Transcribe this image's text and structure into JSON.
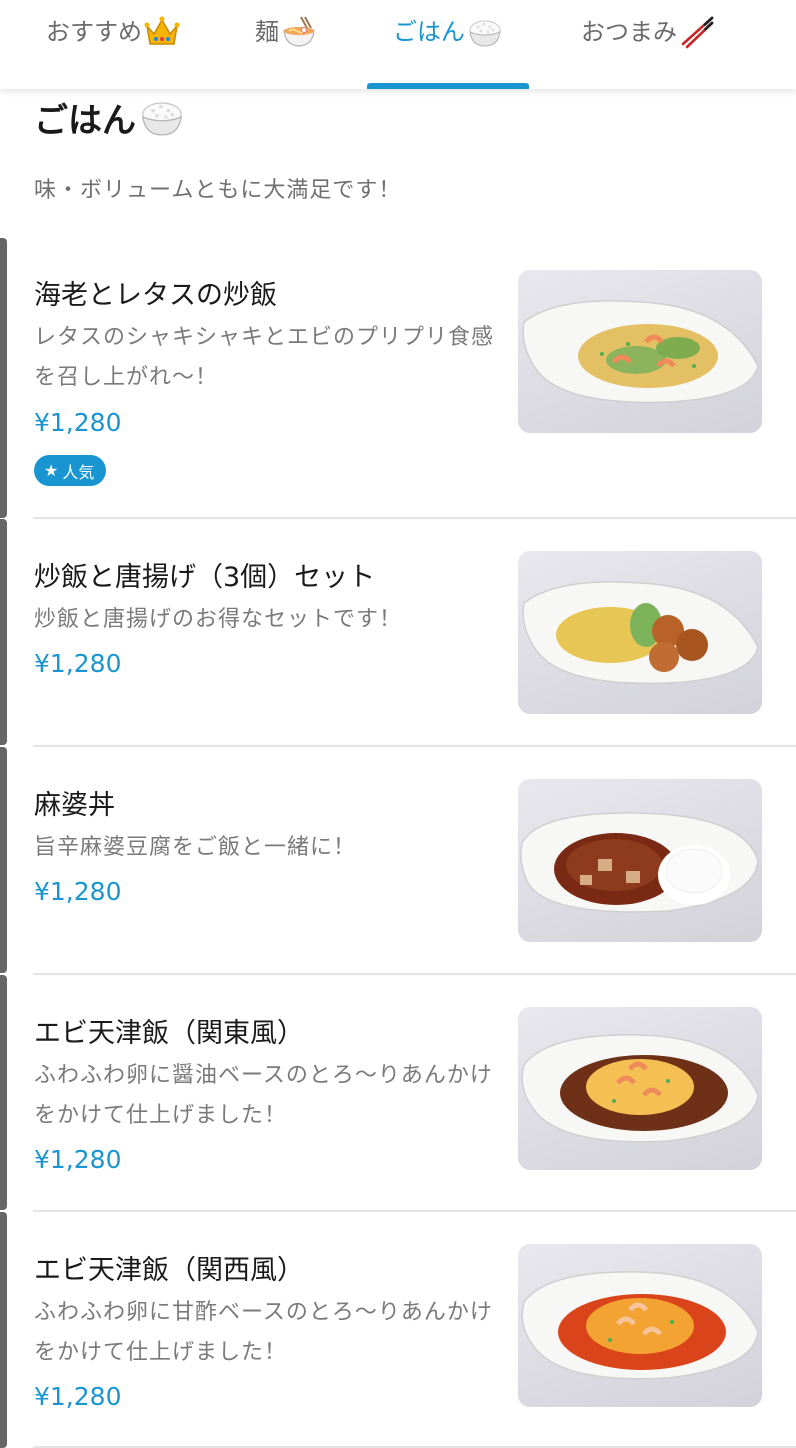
{
  "tabs": [
    {
      "label": "おすすめ",
      "icon": "crown-icon",
      "active": false
    },
    {
      "label": "麺",
      "icon": "noodle-bowl-icon",
      "active": false
    },
    {
      "label": "ごはん",
      "icon": "rice-bowl-icon",
      "active": true
    },
    {
      "label": "おつまみ",
      "icon": "chopsticks-icon",
      "active": false
    }
  ],
  "section": {
    "title": "ごはん",
    "icon": "rice-bowl-icon",
    "description": "味・ボリュームともに大満足です！"
  },
  "items": [
    {
      "name": "海老とレタスの炒飯",
      "description": "レタスのシャキシャキとエビのプリプリ食感を召し上がれ〜！",
      "price": "¥1,280",
      "badge": "人気",
      "photo": "shrimp-lettuce-fried-rice"
    },
    {
      "name": "炒飯と唐揚げ（3個）セット",
      "description": "炒飯と唐揚げのお得なセットです！",
      "price": "¥1,280",
      "photo": "fried-rice-karaage-set"
    },
    {
      "name": "麻婆丼",
      "description": "旨辛麻婆豆腐をご飯と一緒に！",
      "price": "¥1,280",
      "photo": "mapo-rice-bowl"
    },
    {
      "name": "エビ天津飯（関東風）",
      "description": "ふわふわ卵に醤油ベースのとろ〜りあんかけをかけて仕上げました！",
      "price": "¥1,280",
      "photo": "shrimp-tenshinhan-kanto"
    },
    {
      "name": "エビ天津飯（関西風）",
      "description": "ふわふわ卵に甘酢ベースのとろ〜りあんかけをかけて仕上げました！",
      "price": "¥1,280",
      "photo": "shrimp-tenshinhan-kansai"
    }
  ],
  "colors": {
    "accent": "#1996d2",
    "text": "#1a1a1a",
    "muted": "#7a7a7a",
    "divider": "#e4e4e4"
  }
}
